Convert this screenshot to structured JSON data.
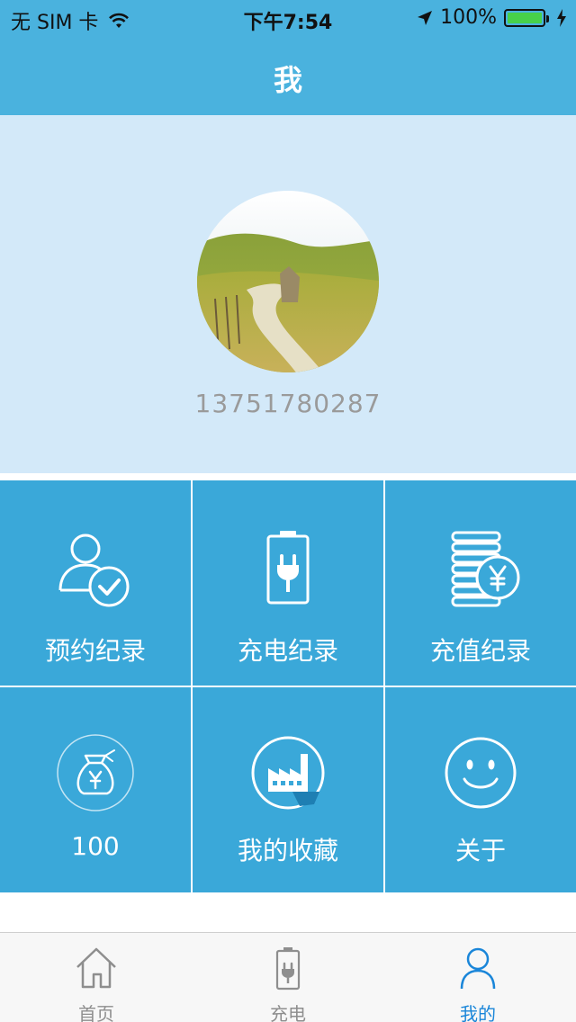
{
  "status_bar": {
    "carrier": "无 SIM 卡",
    "time": "下午7:54",
    "battery_text": "100%",
    "wifi_icon": "wifi-icon",
    "location_icon": "location-arrow-icon",
    "charging_icon": "bolt-icon"
  },
  "nav": {
    "title": "我"
  },
  "profile": {
    "phone": "13751780287",
    "avatar_icon": "landscape-avatar-image"
  },
  "menu": [
    {
      "label": "预约纪录",
      "icon": "user-check-icon"
    },
    {
      "label": "充电纪录",
      "icon": "battery-plug-icon"
    },
    {
      "label": "充值纪录",
      "icon": "coins-yuan-icon"
    },
    {
      "label": "100",
      "icon": "money-bag-icon"
    },
    {
      "label": "我的收藏",
      "icon": "factory-badge-icon"
    },
    {
      "label": "关于",
      "icon": "smiley-icon"
    }
  ],
  "tabbar": {
    "tabs": [
      {
        "label": "首页",
        "icon": "home-icon",
        "active": false
      },
      {
        "label": "充电",
        "icon": "battery-plug-icon",
        "active": false
      },
      {
        "label": "我的",
        "icon": "person-icon",
        "active": true
      }
    ]
  },
  "colors": {
    "header": "#4ab2de",
    "profile_bg": "#d3e9f9",
    "grid_cell": "#3aa8d9",
    "tab_active": "#1a86d9",
    "tab_inactive": "#8e8e8e"
  }
}
